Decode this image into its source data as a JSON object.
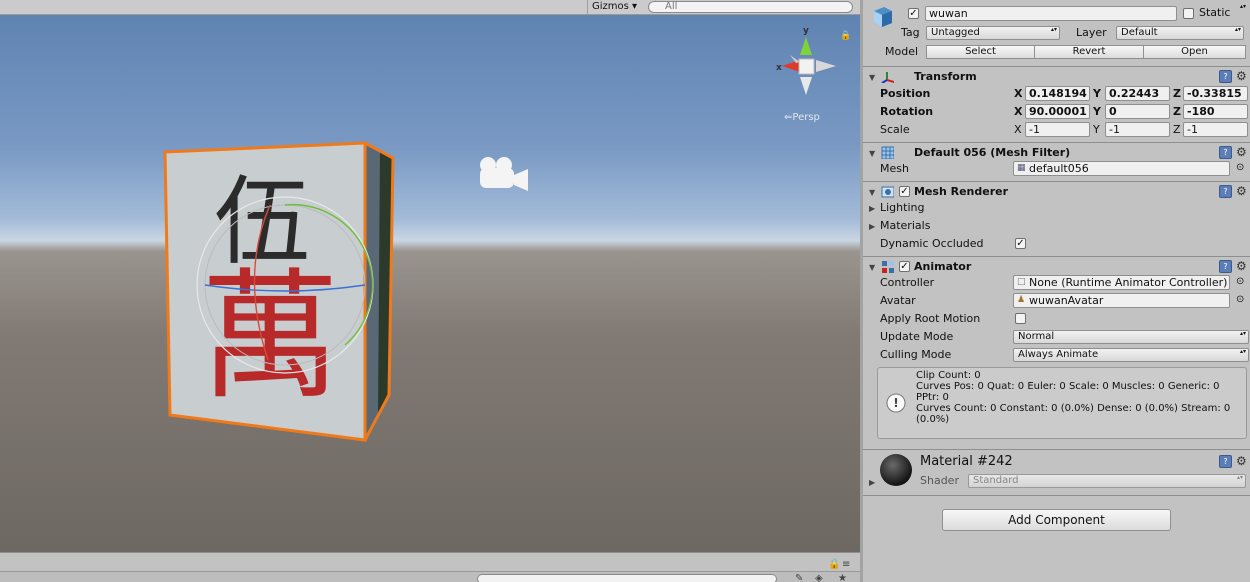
{
  "scene": {
    "gizmos_label": "Gizmos",
    "search_placeholder": "All",
    "gizmo": {
      "x_label": "x",
      "y_label": "y",
      "persp_label": "Persp"
    },
    "tile": {
      "top_glyph": "伍",
      "bottom_glyph": "萬"
    }
  },
  "inspector": {
    "object": {
      "name": "wuwan",
      "static_label": "Static",
      "tag_label": "Tag",
      "tag_value": "Untagged",
      "layer_label": "Layer",
      "layer_value": "Default",
      "model_label": "Model",
      "select_label": "Select",
      "revert_label": "Revert",
      "open_label": "Open"
    },
    "transform": {
      "title": "Transform",
      "position_label": "Position",
      "rotation_label": "Rotation",
      "scale_label": "Scale",
      "x": "X",
      "y": "Y",
      "z": "Z",
      "position": {
        "x": "0.148194",
        "y": "0.22443",
        "z": "-0.33815"
      },
      "rotation": {
        "x": "90.00001",
        "y": "0",
        "z": "-180"
      },
      "scale": {
        "x": "-1",
        "y": "-1",
        "z": "-1"
      }
    },
    "mesh_filter": {
      "title": "Default 056 (Mesh Filter)",
      "mesh_label": "Mesh",
      "mesh_value": "default056"
    },
    "mesh_renderer": {
      "title": "Mesh Renderer",
      "lighting_label": "Lighting",
      "materials_label": "Materials",
      "dynamic_occluded_label": "Dynamic Occluded"
    },
    "animator": {
      "title": "Animator",
      "controller_label": "Controller",
      "controller_value": "None (Runtime Animator Controller)",
      "avatar_label": "Avatar",
      "avatar_value": "wuwanAvatar",
      "apply_root_motion_label": "Apply Root Motion",
      "update_mode_label": "Update Mode",
      "update_mode_value": "Normal",
      "culling_mode_label": "Culling Mode",
      "culling_mode_value": "Always Animate",
      "info_lines": [
        "Clip Count: 0",
        "Curves Pos: 0 Quat: 0 Euler: 0 Scale: 0 Muscles: 0 Generic: 0",
        "PPtr: 0",
        "Curves Count: 0 Constant: 0 (0.0%) Dense: 0 (0.0%) Stream: 0",
        "(0.0%)"
      ]
    },
    "material": {
      "name": "Material #242",
      "shader_label": "Shader",
      "shader_value": "Standard"
    },
    "add_component_label": "Add Component"
  }
}
